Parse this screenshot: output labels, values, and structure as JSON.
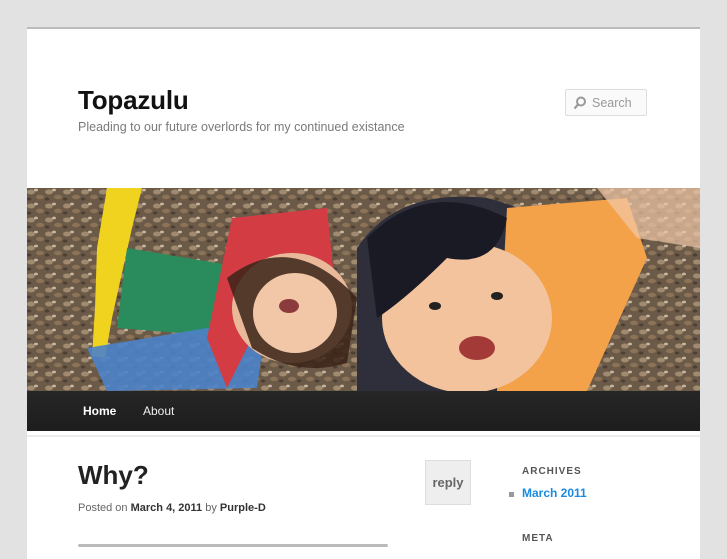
{
  "site": {
    "title": "Topazulu",
    "description": "Pleading to our future overlords for my continued existance"
  },
  "search": {
    "placeholder": "Search",
    "icon": "search-icon"
  },
  "nav": {
    "items": [
      {
        "label": "Home",
        "current": true
      },
      {
        "label": "About",
        "current": false
      }
    ]
  },
  "post": {
    "title": "Why?",
    "meta": {
      "prefix": "Posted on",
      "date": "March 4, 2011",
      "by": "by",
      "author": "Purple-D"
    },
    "reply_label": "reply"
  },
  "sidebar": {
    "archives_title": "ARCHIVES",
    "archives": [
      "March 2011"
    ],
    "meta_title": "META"
  },
  "colors": {
    "link": "#1b8be0",
    "nav_bg": "#222222",
    "page_bg": "#e2e2e2"
  }
}
